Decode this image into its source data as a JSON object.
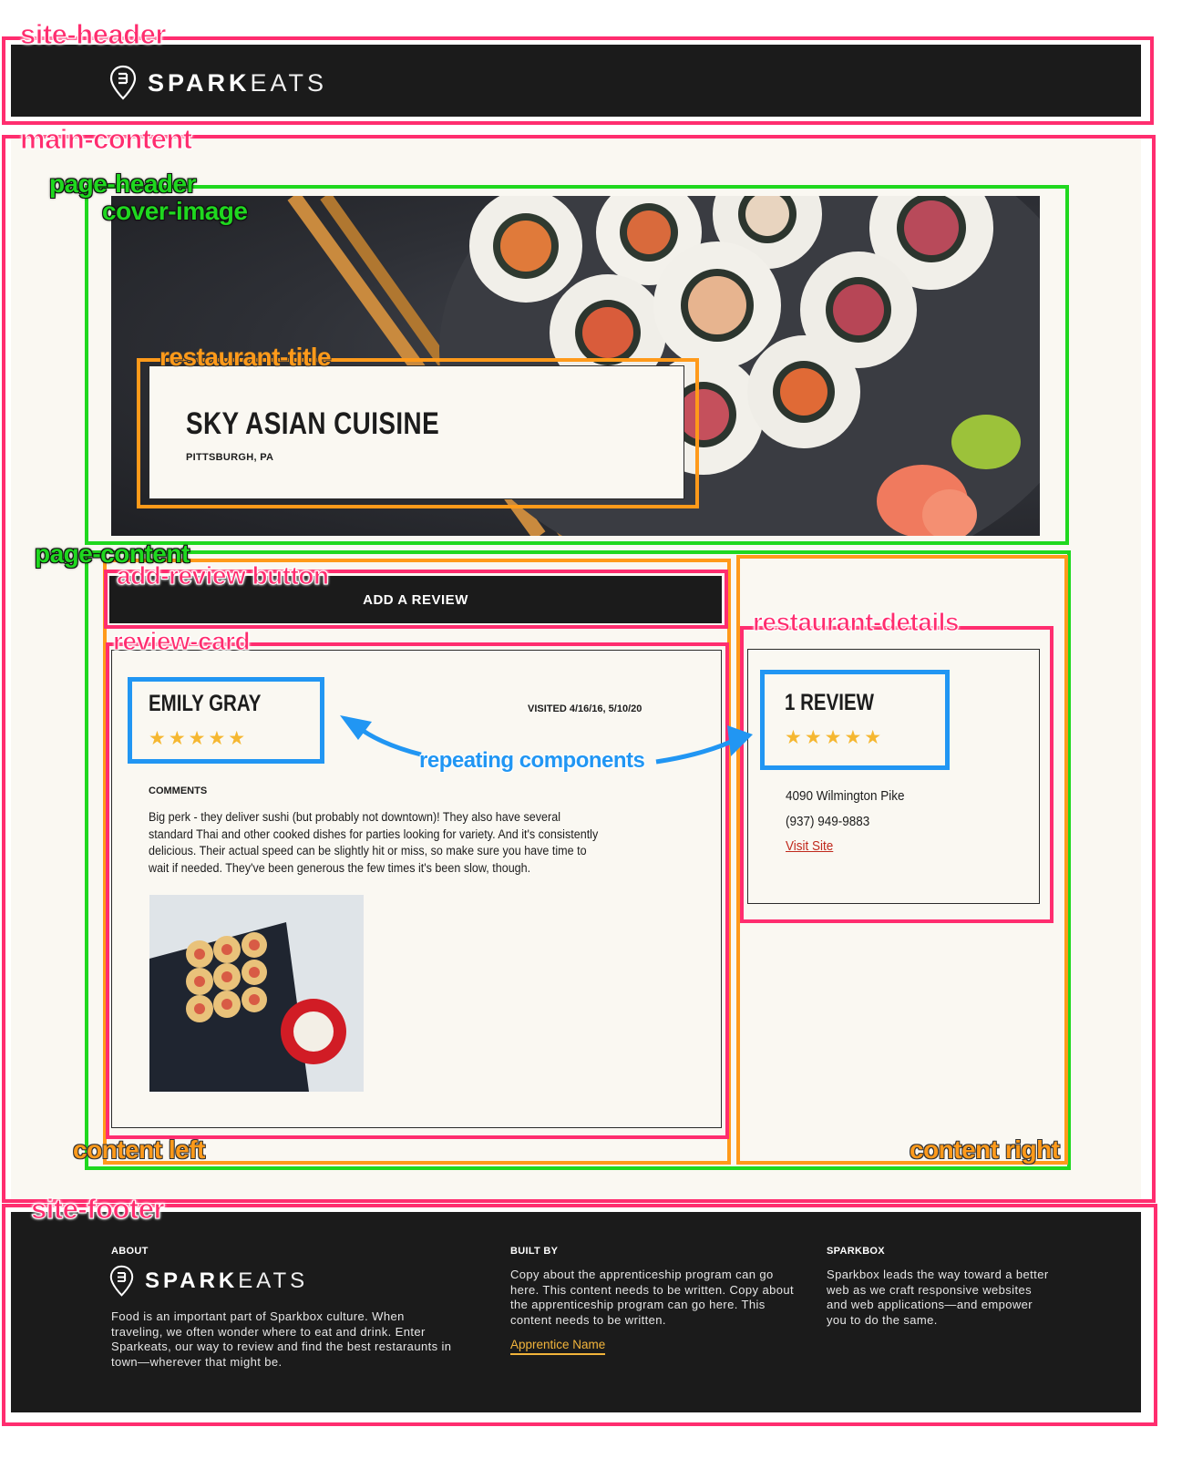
{
  "annotations": {
    "site_header": "site-header",
    "main_content": "main-content",
    "page_header": "page-header",
    "cover_image": "cover-image",
    "restaurant_title": "restaurant-title",
    "page_content": "page-content",
    "add_review_button": "add-review button",
    "review_card": "review-card",
    "restaurant_details": "restaurant-details",
    "repeating_components": "repeating components",
    "content_left": "content left",
    "content_right": "content right",
    "site_footer": "site-footer"
  },
  "colors": {
    "pink": "#ff2d6f",
    "green": "#1fd81f",
    "orange": "#ff9a1a",
    "blue": "#2196f3",
    "dark": "#1b1b1b",
    "cream": "#faf8f2",
    "star": "#f5b731",
    "link_red": "#c0281c",
    "link_gold": "#f2b43b"
  },
  "header": {
    "logo_bold": "SPARK",
    "logo_light": "EATS",
    "logo_icon": "map-pin-fork-icon"
  },
  "restaurant": {
    "name": "SKY ASIAN CUISINE",
    "location": "PITTSBURGH, PA"
  },
  "add_review_label": "ADD A REVIEW",
  "review": {
    "author": "EMILY GRAY",
    "rating": 5,
    "stars": "★★★★★",
    "visited": "VISITED 4/16/16, 5/10/20",
    "comments_heading": "COMMENTS",
    "comments": "Big perk - they deliver sushi (but probably not downtown)! They also have several standard Thai and other cooked dishes for parties looking for variety. And it's consistently delicious. Their actual speed can be slightly hit or miss, so make sure you have time to wait if needed. They've been generous the few times it's been slow, though."
  },
  "details": {
    "review_count": "1 REVIEW",
    "rating": 5,
    "stars": "★★★★★",
    "address": "4090 Wilmington Pike",
    "phone": "(937) 949-9883",
    "link": "Visit Site"
  },
  "footer": {
    "about_heading": "ABOUT",
    "about_text": "Food is an important part of Sparkbox culture. When traveling, we often wonder where to eat and drink. Enter Sparkeats, our way to review and find the best restaraunts in town—wherever that might be.",
    "built_heading": "BUILT BY",
    "built_text": "Copy about the apprenticeship program can go here. This content needs to be written. Copy about the apprenticeship program can go here. This content needs to be written.",
    "built_link": "Apprentice Name",
    "sparkbox_heading": "SPARKBOX",
    "sparkbox_text": "Sparkbox leads the way toward a better web as we craft responsive websites and web applications—and empower you to do the same."
  }
}
